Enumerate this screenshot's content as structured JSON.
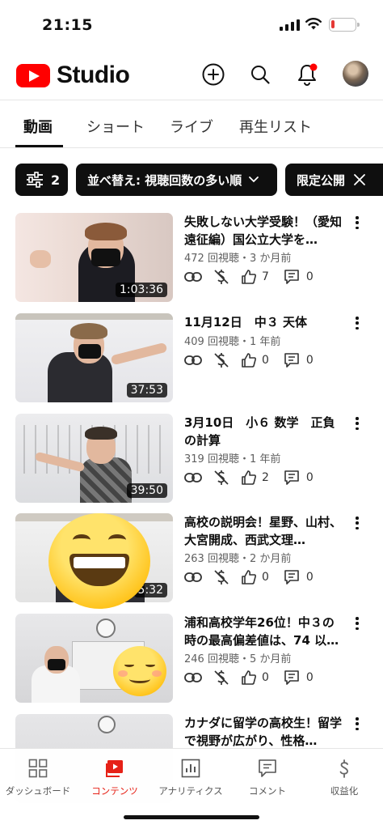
{
  "status_bar": {
    "time": "21:15"
  },
  "app": {
    "logo_text": "Studio",
    "brand_color": "#ff0000"
  },
  "header_icons": [
    "add-icon",
    "search-icon",
    "notifications-icon",
    "account-avatar"
  ],
  "tabs": [
    {
      "label": "動画",
      "active": true
    },
    {
      "label": "ショート",
      "active": false
    },
    {
      "label": "ライブ",
      "active": false
    },
    {
      "label": "再生リスト",
      "active": false
    }
  ],
  "filters": {
    "filter_count": "2",
    "sort_label": "並べ替え: 視聴回数の多い順",
    "visibility_label": "限定公開"
  },
  "videos": [
    {
      "title": "失敗しない大学受験！（愛知遠征編）国公立大学を…",
      "meta": "472 回視聴・3 か月前",
      "duration": "1:03:36",
      "likes": "7",
      "comments": "0"
    },
    {
      "title": "11月12日　中３ 天体",
      "meta": "409 回視聴・1 年前",
      "duration": "37:53",
      "likes": "0",
      "comments": "0"
    },
    {
      "title": "3月10日　小６ 数学　正負の計算",
      "meta": "319 回視聴・1 年前",
      "duration": "39:50",
      "likes": "2",
      "comments": "0"
    },
    {
      "title": "高校の説明会！星野、山村、大宮開成、西武文理…",
      "meta": "263 回視聴・2 か月前",
      "duration": "5:32",
      "likes": "0",
      "comments": "0"
    },
    {
      "title": "浦和高校学年26位！中３の時の最高偏差値は、74 以…",
      "meta": "246 回視聴・5 か月前",
      "duration": "",
      "likes": "0",
      "comments": "0"
    },
    {
      "title": "カナダに留学の高校生！留学で視野が広がり、性格…",
      "meta": "",
      "duration": "",
      "likes": "",
      "comments": ""
    }
  ],
  "bottom_nav": [
    {
      "label": "ダッシュボード",
      "icon": "dashboard-icon",
      "active": false
    },
    {
      "label": "コンテンツ",
      "icon": "content-icon",
      "active": true
    },
    {
      "label": "アナリティクス",
      "icon": "analytics-icon",
      "active": false
    },
    {
      "label": "コメント",
      "icon": "comments-icon",
      "active": false
    },
    {
      "label": "収益化",
      "icon": "monetization-icon",
      "active": false
    }
  ]
}
